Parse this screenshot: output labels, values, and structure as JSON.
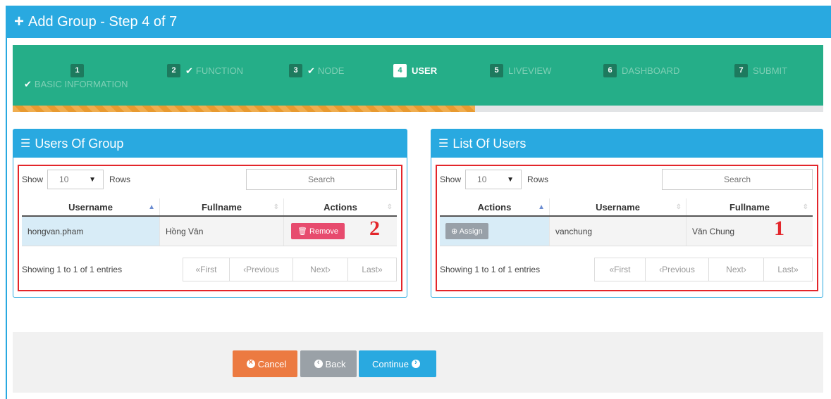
{
  "header": {
    "title": "Add Group - Step 4 of 7"
  },
  "wizard": {
    "progress_percent": 57,
    "steps": [
      {
        "num": "1",
        "label": "BASIC INFORMATION",
        "done": true
      },
      {
        "num": "2",
        "label": "FUNCTION",
        "done": true
      },
      {
        "num": "3",
        "label": "NODE",
        "done": true
      },
      {
        "num": "4",
        "label": "USER",
        "active": true
      },
      {
        "num": "5",
        "label": "LIVEVIEW"
      },
      {
        "num": "6",
        "label": "DASHBOARD"
      },
      {
        "num": "7",
        "label": "SUBMIT"
      }
    ]
  },
  "users_of_group": {
    "title": "Users Of Group",
    "show_label": "Show",
    "rows_value": "10",
    "rows_label": "Rows",
    "search_placeholder": "Search",
    "columns": [
      "Username",
      "Fullname",
      "Actions"
    ],
    "rows": [
      {
        "username": "hongvan.pham",
        "fullname": "Hồng Vân",
        "action": "Remove"
      }
    ],
    "info": "Showing 1 to 1 of 1 entries",
    "pager": [
      "First",
      "Previous",
      "Next",
      "Last"
    ],
    "marker": "2"
  },
  "list_of_users": {
    "title": "List Of Users",
    "show_label": "Show",
    "rows_value": "10",
    "rows_label": "Rows",
    "search_placeholder": "Search",
    "columns": [
      "Actions",
      "Username",
      "Fullname"
    ],
    "rows": [
      {
        "action": "Assign",
        "username": "vanchung",
        "fullname": "Văn Chung"
      }
    ],
    "info": "Showing 1 to 1 of 1 entries",
    "pager": [
      "First",
      "Previous",
      "Next",
      "Last"
    ],
    "marker": "1"
  },
  "buttons": {
    "cancel": "Cancel",
    "back": "Back",
    "continue": "Continue"
  },
  "colors": {
    "primary": "#29a9e0",
    "wizard": "#25ae88",
    "danger": "#e74b6e",
    "cancel": "#ec7a41",
    "annotation": "#e3262b"
  }
}
